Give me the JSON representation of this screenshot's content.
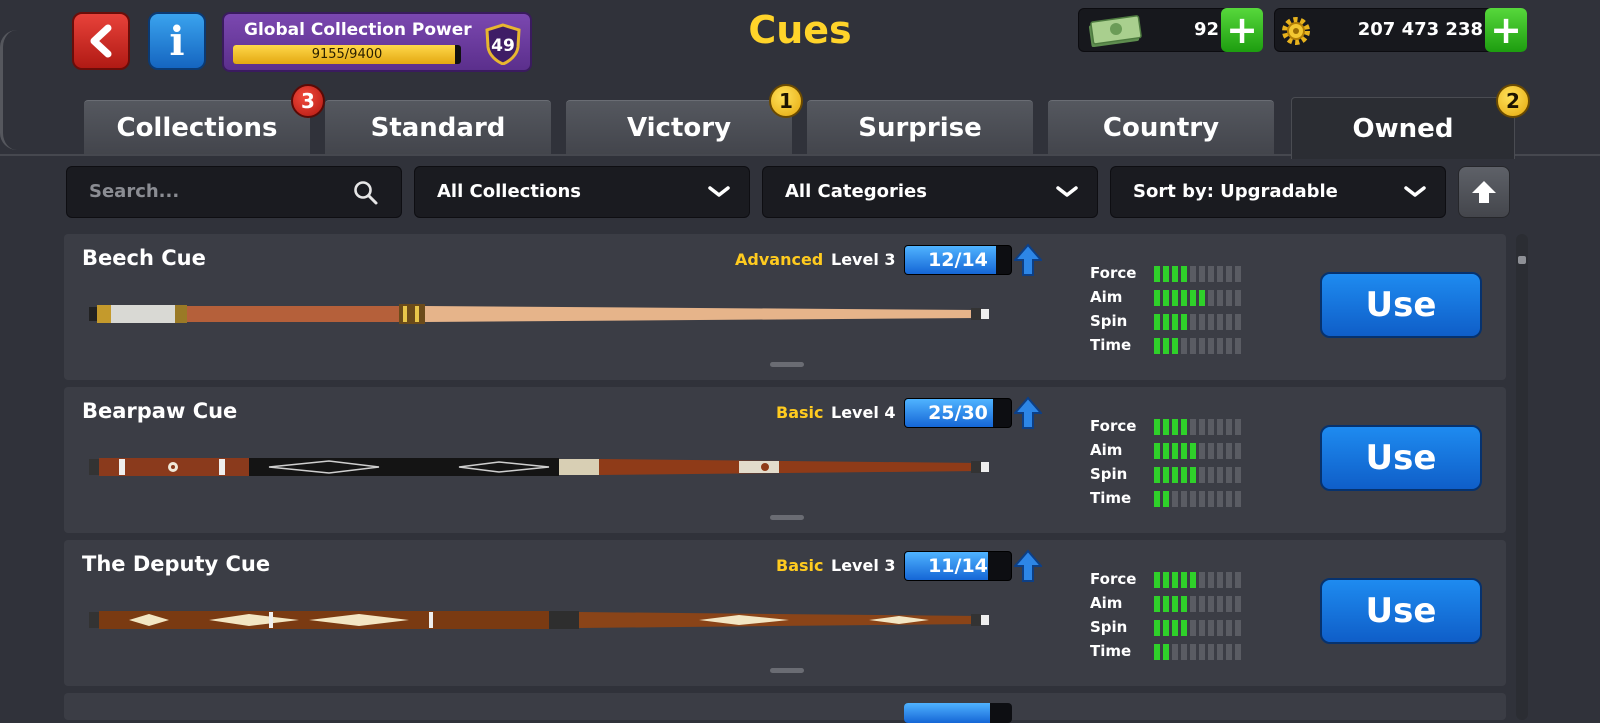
{
  "header": {
    "title": "Cues",
    "power": {
      "label": "Global Collection Power",
      "progress": "9155/9400",
      "fraction": 0.974,
      "level": "49"
    },
    "cash": {
      "value": "92",
      "icon": "cash-icon"
    },
    "coins": {
      "value": "207 473 238",
      "icon": "coins-icon"
    }
  },
  "tabs": [
    {
      "label": "Collections",
      "badge": "3",
      "badge_color": "red"
    },
    {
      "label": "Standard"
    },
    {
      "label": "Victory",
      "badge": "1",
      "badge_color": "yellow"
    },
    {
      "label": "Surprise"
    },
    {
      "label": "Country"
    },
    {
      "label": "Owned",
      "badge": "2",
      "badge_color": "yellow",
      "active": true
    }
  ],
  "filters": {
    "search_placeholder": "Search...",
    "collection": "All Collections",
    "category": "All Categories",
    "sort": "Sort by: Upgradable"
  },
  "stat_labels": {
    "force": "Force",
    "aim": "Aim",
    "spin": "Spin",
    "time": "Time"
  },
  "cues": [
    {
      "name": "Beech Cue",
      "rarity": "Advanced",
      "level": "Level 3",
      "progress": "12/14",
      "fraction": 0.857,
      "stats": {
        "force": 4,
        "aim": 6,
        "spin": 4,
        "time": 3
      },
      "use_label": "Use"
    },
    {
      "name": "Bearpaw Cue",
      "rarity": "Basic",
      "level": "Level 4",
      "progress": "25/30",
      "fraction": 0.833,
      "stats": {
        "force": 4,
        "aim": 5,
        "spin": 5,
        "time": 2
      },
      "use_label": "Use"
    },
    {
      "name": "The Deputy Cue",
      "rarity": "Basic",
      "level": "Level 3",
      "progress": "11/14",
      "fraction": 0.786,
      "stats": {
        "force": 5,
        "aim": 4,
        "spin": 4,
        "time": 2
      },
      "use_label": "Use"
    }
  ],
  "colors": {
    "accent_yellow": "#ffd42a",
    "stat_green": "#2fd12a",
    "use_blue": "#1565d6"
  }
}
